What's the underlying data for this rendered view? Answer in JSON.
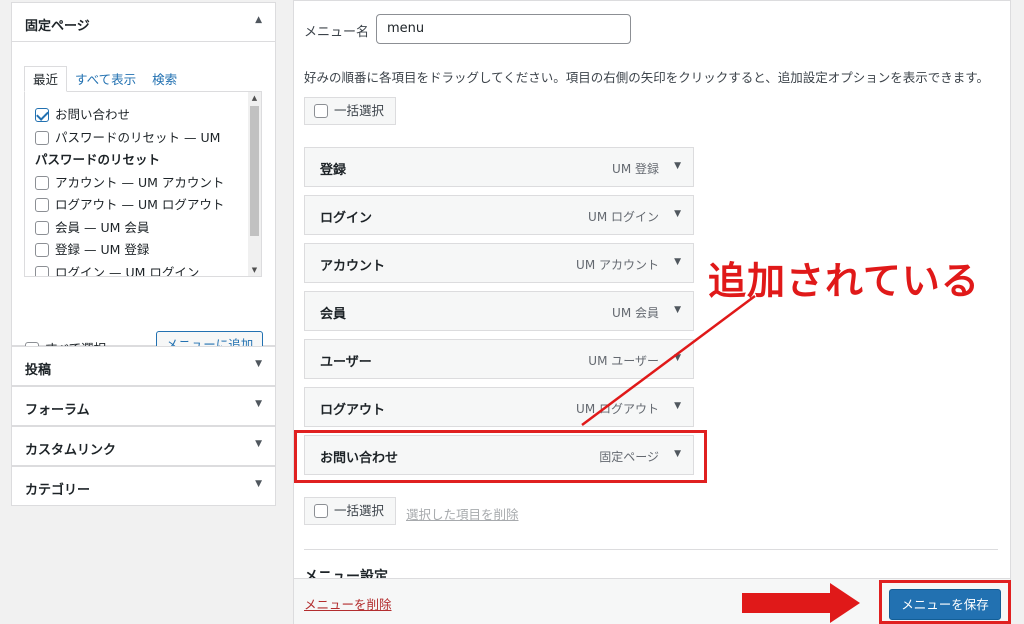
{
  "left_panel": {
    "pages_section": {
      "title": "固定ページ",
      "tabs": [
        "最近",
        "すべて表示",
        "検索"
      ],
      "items": [
        {
          "label": "お問い合わせ",
          "checked": true
        },
        {
          "label": "パスワードのリセット — UM",
          "checked": false
        },
        {
          "label": "パスワードのリセット",
          "group": true
        },
        {
          "label": "アカウント — UM アカウント",
          "checked": false
        },
        {
          "label": "ログアウト — UM ログアウト",
          "checked": false
        },
        {
          "label": "会員 — UM 会員",
          "checked": false
        },
        {
          "label": "登録 — UM 登録",
          "checked": false
        },
        {
          "label": "ログイン — UM ログイン",
          "checked": false
        }
      ],
      "select_all_label": "すべて選択",
      "add_button_label": "メニューに追加"
    },
    "other_sections": [
      "投稿",
      "フォーラム",
      "カスタムリンク",
      "カテゴリー"
    ]
  },
  "menu_editor": {
    "name_label": "メニュー名",
    "name_value": "menu",
    "instructions": "好みの順番に各項目をドラッグしてください。項目の右側の矢印をクリックすると、追加設定オプションを表示できます。",
    "bulk_select_label": "一括選択",
    "delete_selected_label": "選択した項目を削除",
    "items": [
      {
        "title": "登録",
        "type": "UM 登録"
      },
      {
        "title": "ログイン",
        "type": "UM ログイン"
      },
      {
        "title": "アカウント",
        "type": "UM アカウント"
      },
      {
        "title": "会員",
        "type": "UM 会員"
      },
      {
        "title": "ユーザー",
        "type": "UM ユーザー"
      },
      {
        "title": "ログアウト",
        "type": "UM ログアウト"
      },
      {
        "title": "お問い合わせ",
        "type": "固定ページ"
      }
    ],
    "menu_settings_heading": "メニュー設定",
    "delete_menu_label": "メニューを削除",
    "save_button_label": "メニューを保存"
  },
  "annotation": {
    "text": "追加されている",
    "color": "#e01919"
  },
  "colors": {
    "accent": "#2271b1",
    "highlight": "#e02020",
    "delete": "#b32d2e"
  }
}
